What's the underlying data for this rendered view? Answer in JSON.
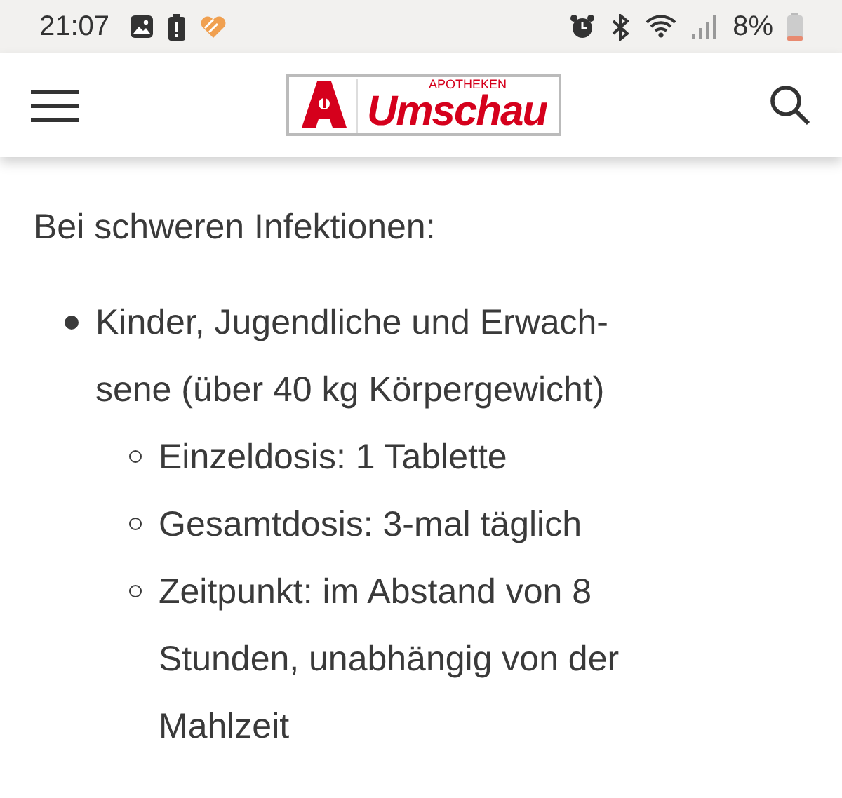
{
  "status_bar": {
    "time": "21:07",
    "battery": "8%"
  },
  "header": {
    "logo": {
      "small": "APOTHEKEN",
      "name": "Umschau"
    }
  },
  "content": {
    "intro": "Bei schweren Infektionen:",
    "items": [
      {
        "text": "Kinder, Jugendliche und Erwach- sene (über 40 kg Körpergewicht)",
        "children": [
          {
            "text": "Einzeldosis: 1 Tablette"
          },
          {
            "text": "Gesamtdosis: 3-mal täglich"
          },
          {
            "text": "Zeitpunkt: im Abstand von 8 Stunden, unabhängig von der Mahlzeit"
          }
        ]
      }
    ]
  }
}
